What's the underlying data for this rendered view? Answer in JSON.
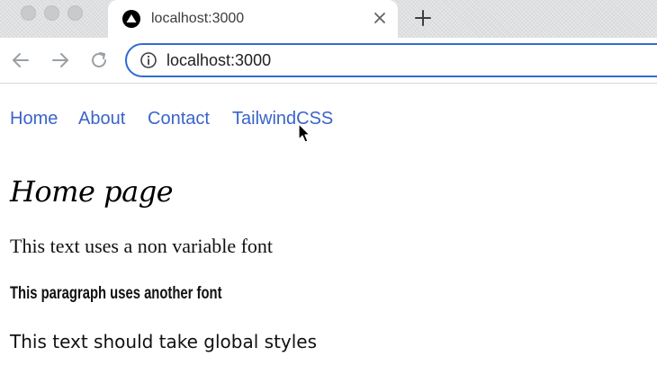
{
  "browser": {
    "tab_title": "localhost:3000",
    "address": "localhost:3000",
    "accent": "#2f6bd8"
  },
  "icons": {
    "favicon": "triangle-icon",
    "close": "close-icon",
    "new_tab": "plus-icon",
    "back": "arrow-left-icon",
    "forward": "arrow-right-icon",
    "reload": "reload-icon",
    "info": "info-icon",
    "cursor": "pointer-cursor-icon"
  },
  "nav": {
    "link_color": "#3a64c8",
    "links": [
      {
        "label": "Home"
      },
      {
        "label": "About"
      },
      {
        "label": "Contact"
      },
      {
        "label": "TailwindCSS"
      }
    ]
  },
  "content": {
    "heading": "Home page",
    "paragraph_1": "This text uses a non variable font",
    "paragraph_2": "This paragraph uses another font",
    "paragraph_3": "This text should take global styles"
  }
}
